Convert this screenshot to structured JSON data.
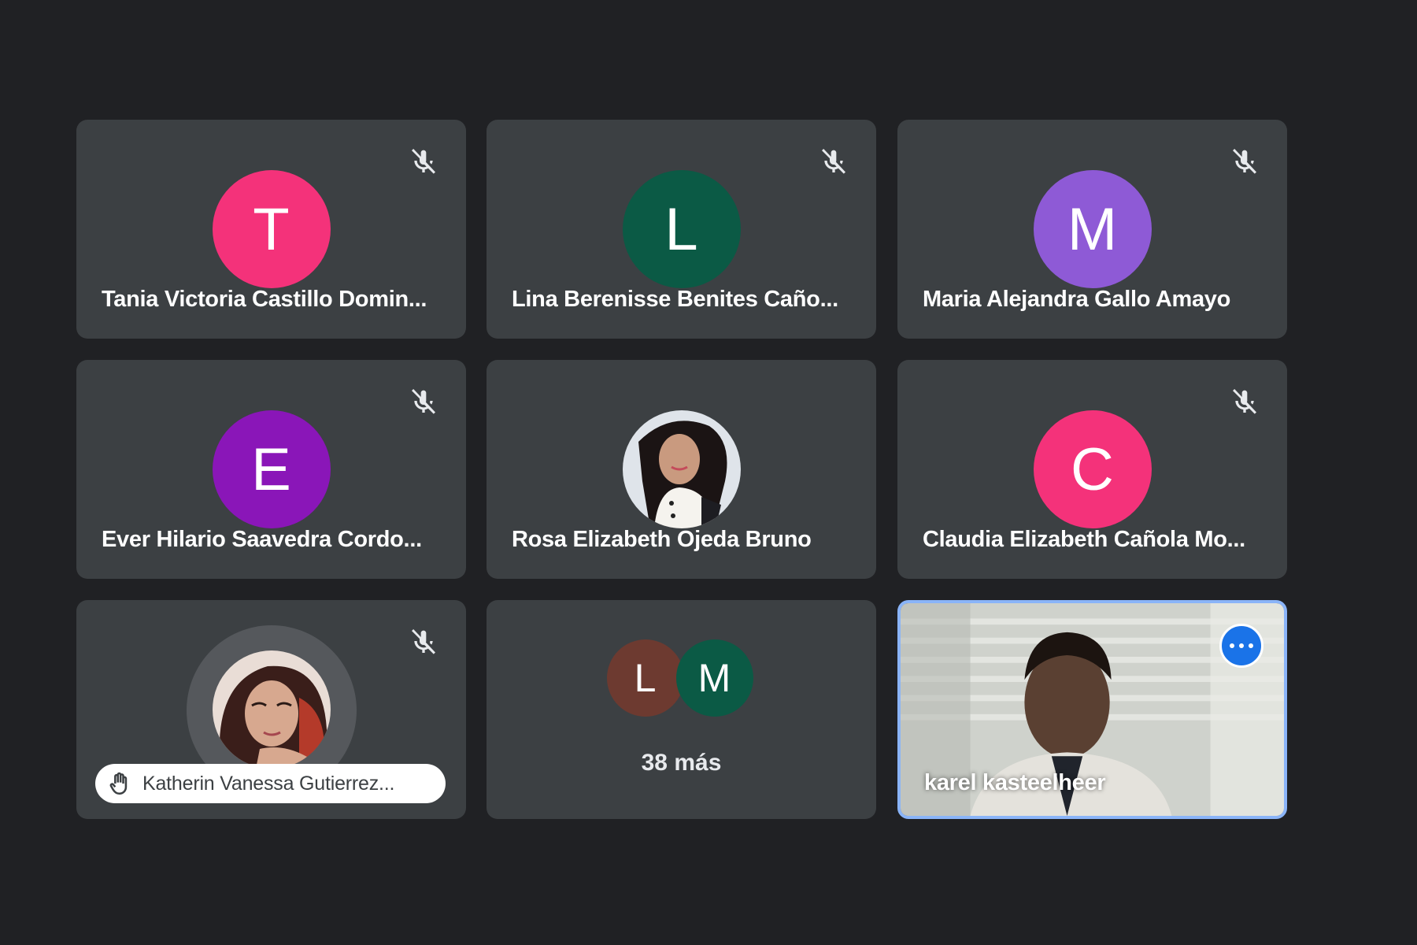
{
  "grid": {
    "tiles": [
      {
        "name": "Tania Victoria Castillo Domin...",
        "initial": "T",
        "avatar_color": "#f4327a",
        "muted": true
      },
      {
        "name": "Lina Berenisse Benites Caño...",
        "initial": "L",
        "avatar_color": "#0b5a45",
        "muted": true
      },
      {
        "name": "Maria Alejandra Gallo Amayo",
        "initial": "M",
        "avatar_color": "#8e5ad6",
        "muted": true
      },
      {
        "name": "Ever Hilario Saavedra Cordo...",
        "initial": "E",
        "avatar_color": "#8a16b8",
        "muted": true
      },
      {
        "name": "Rosa Elizabeth Ojeda Bruno",
        "photo": true,
        "muted": false
      },
      {
        "name": "Claudia Elizabeth Cañola Mo...",
        "initial": "C",
        "avatar_color": "#f4327a",
        "muted": true
      },
      {
        "name": "Katherin Vanessa Gutierrez...",
        "photo": true,
        "hand_raised": true,
        "muted": true
      },
      {
        "more_count_label": "38 más",
        "mini_avatars": [
          {
            "initial": "L",
            "color": "#6d3a30"
          },
          {
            "initial": "M",
            "color": "#0b5a45"
          }
        ]
      },
      {
        "name": "karel kasteelheer",
        "self_view": true,
        "active_speaker": true
      }
    ]
  },
  "colors": {
    "background": "#202124",
    "tile": "#3c4043",
    "active_border": "#8ab4f8",
    "options_button": "#1a73e8"
  }
}
